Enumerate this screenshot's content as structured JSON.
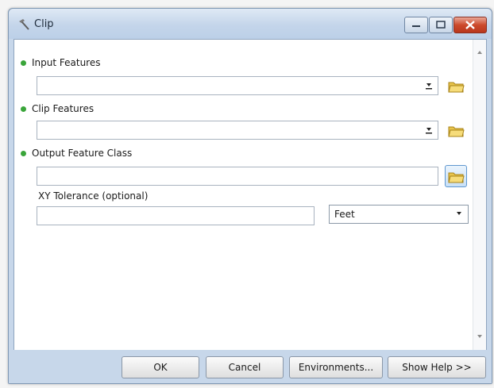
{
  "window": {
    "title": "Clip"
  },
  "fields": [
    {
      "label": "Input Features",
      "value": ""
    },
    {
      "label": "Clip Features",
      "value": ""
    },
    {
      "label": "Output Feature Class",
      "value": ""
    },
    {
      "label": "XY Tolerance (optional)",
      "value": ""
    }
  ],
  "xy_unit": "Feet",
  "buttons": {
    "ok": "OK",
    "cancel": "Cancel",
    "environments": "Environments...",
    "show_help": "Show Help >>"
  },
  "icons": {
    "app": "hammer-icon",
    "minimize": "minimize-icon",
    "maximize": "maximize-icon",
    "close": "close-icon",
    "folder": "open-folder-icon",
    "required": "green-dot-icon",
    "dropdown": "chevron-down-icon"
  },
  "colors": {
    "required_dot": "#3aa53a",
    "close_button": "#cc4a2c",
    "frame": "#c7d7ea"
  }
}
